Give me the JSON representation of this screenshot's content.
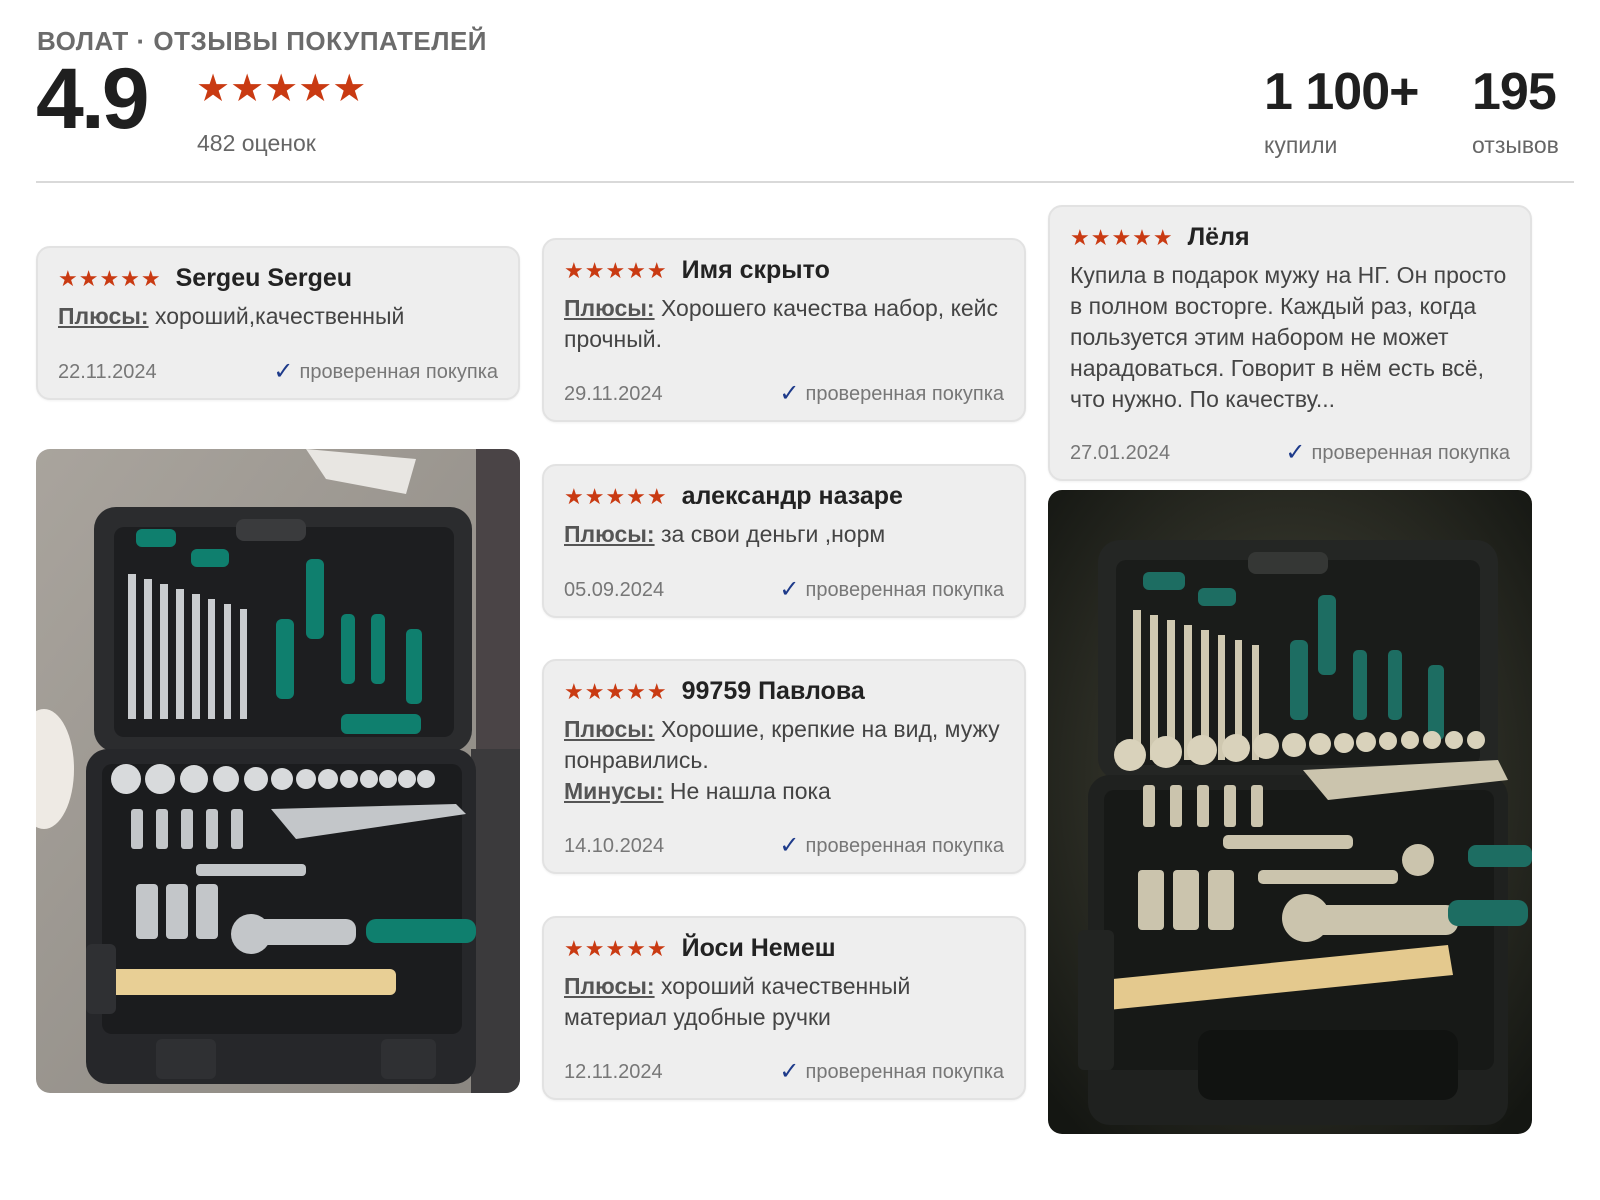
{
  "header": {
    "brand": "ВОЛАТ · ОТЗЫВЫ ПОКУПАТЕЛЕЙ",
    "rating": "4.9",
    "stars": "★★★★★",
    "ratings_count": "482 оценок",
    "bought_value": "1 100+",
    "bought_label": "купили",
    "reviews_value": "195",
    "reviews_label": "отзывов"
  },
  "verified_label": "проверенная покупка",
  "verified_icon": "check-icon",
  "colors": {
    "star": "#c93a12",
    "check": "#1d3a8a",
    "card_bg": "#eeeeee"
  },
  "reviews": [
    {
      "name": "Sergeu Sergeu",
      "stars": "★★★★★",
      "pros_label": "Плюсы:",
      "pros": "хороший,качественный",
      "date": "22.11.2024"
    },
    {
      "name": "Имя скрыто",
      "stars": "★★★★★",
      "pros_label": "Плюсы:",
      "pros": "Хорошего качества набор, кейс прочный.",
      "date": "29.11.2024"
    },
    {
      "name": "Лёля",
      "stars": "★★★★★",
      "text": "Купила в подарок мужу на НГ. Он просто в полном восторге. Каждый раз, когда пользуется этим набором не может нарадоваться. Говорит в нём есть всё, что нужно. По качеству...",
      "date": "27.01.2024"
    },
    {
      "name": "александр назаре",
      "stars": "★★★★★",
      "pros_label": "Плюсы:",
      "pros": "за свои деньги ,норм",
      "date": "05.09.2024"
    },
    {
      "name": "99759 Павлова",
      "stars": "★★★★★",
      "pros_label": "Плюсы:",
      "pros": "Хорошие, крепкие на вид, мужу понравились.",
      "cons_label": "Минусы:",
      "cons": "Не нашла пока",
      "date": "14.10.2024"
    },
    {
      "name": "Йоси Немеш",
      "stars": "★★★★★",
      "pros_label": "Плюсы:",
      "pros": "хороший качественный материал удобные ручки",
      "date": "12.11.2024"
    }
  ],
  "photos": [
    {
      "name": "tool-set-photo-1"
    },
    {
      "name": "tool-set-photo-2"
    }
  ]
}
